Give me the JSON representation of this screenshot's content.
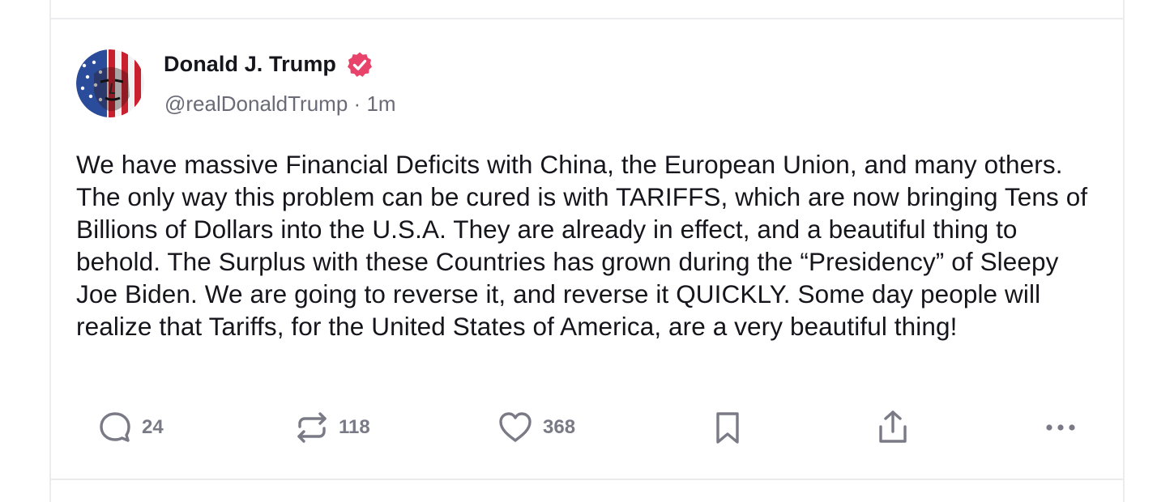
{
  "post": {
    "author": {
      "display_name": "Donald J. Trump",
      "verified": true,
      "handle": "@realDonaldTrump",
      "separator": "·",
      "timestamp": "1m",
      "avatar_icon": "flag-face-avatar"
    },
    "text": "We have massive Financial Deficits with China, the European Union, and many others. The only way this problem can be cured is with TARIFFS, which are now bringing Tens of Billions of Dollars into the U.S.A. They are already in effect, and a beautiful thing to behold. The Surplus with these Countries has grown during the “Presidency” of Sleepy Joe Biden. We are going to reverse it, and reverse it QUICKLY. Some day people will realize that Tariffs, for the United States of America, are a very beautiful thing!",
    "actions": {
      "reply": {
        "icon": "reply-icon",
        "count": "24"
      },
      "repost": {
        "icon": "repost-icon",
        "count": "118"
      },
      "like": {
        "icon": "heart-icon",
        "count": "368"
      },
      "bookmark": {
        "icon": "bookmark-icon"
      },
      "share": {
        "icon": "share-icon"
      },
      "more": {
        "icon": "more-icon"
      }
    }
  },
  "colors": {
    "text": "#15151c",
    "secondary": "#6b6b78",
    "icon": "#7a7a86",
    "verified_badge": "#e8436a",
    "divider": "#ececef"
  }
}
